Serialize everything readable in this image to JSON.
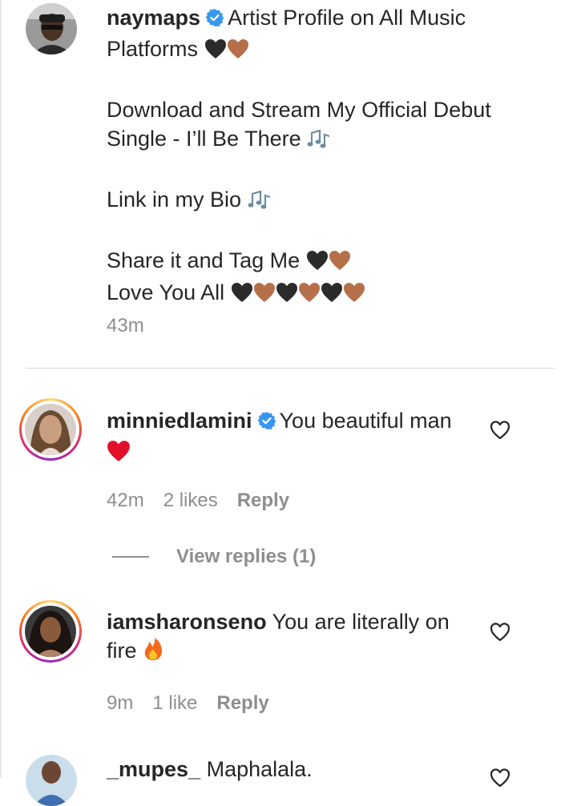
{
  "caption": {
    "username": "naymaps",
    "lines": [
      "Artist Profile on All Music",
      "Platforms",
      "Download and Stream My Official Debut",
      "Single - I’ll Be There",
      "Link in my Bio",
      "Share it and Tag Me",
      "Love You All"
    ],
    "time": "43m"
  },
  "comments": [
    {
      "username": "minniedlamini",
      "text_line1": "You beautiful man",
      "time": "42m",
      "likes": "2 likes",
      "reply_label": "Reply",
      "view_replies": "View replies (1)"
    },
    {
      "username": "iamsharonseno",
      "text_line1": "You are literally on",
      "text_line2": "fire",
      "time": "9m",
      "likes": "1 like",
      "reply_label": "Reply"
    },
    {
      "username": "_mupes_",
      "text_line1": "Maphalala."
    }
  ],
  "colors": {
    "text": "#262626",
    "secondary": "#8e8e8e",
    "verified": "#3897f0",
    "divider": "#dbdbdb",
    "black_heart": "#2b2b2b",
    "brown_heart": "#b5704a",
    "red_heart": "#e0102b"
  },
  "icons": [
    "verified-badge-icon",
    "black-heart-icon",
    "brown-heart-icon",
    "musical-notes-icon",
    "red-heart-icon",
    "fire-icon",
    "like-heart-outline-icon"
  ]
}
